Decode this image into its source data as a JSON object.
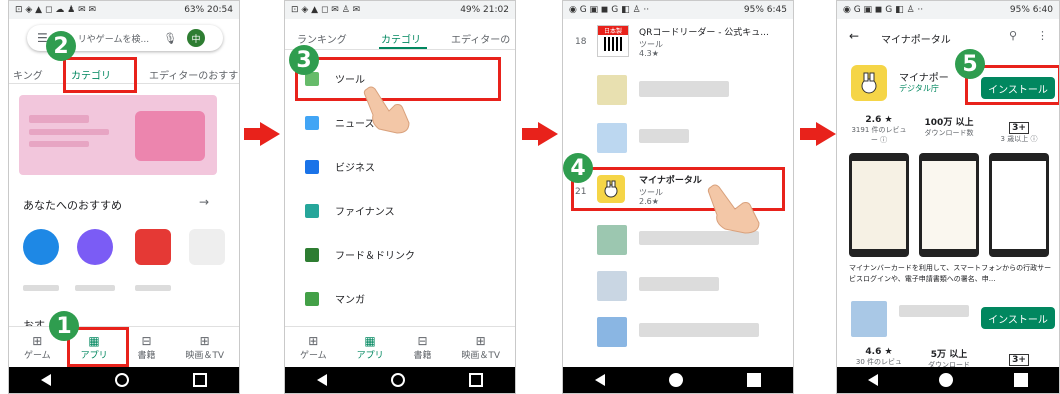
{
  "screen1": {
    "status_left": "⊡ ◈ ▲ ◻ ☁ ♟ ✉ ✉",
    "status_right": "63% 20:54",
    "search_placeholder": "リやゲームを検...",
    "avatar_letter": "中",
    "tabs": [
      "キング",
      "カテゴリ",
      "エディターのおすす"
    ],
    "section_title": "あなたへのおすすめ",
    "section_arrow": "→",
    "partial_heading": "おす",
    "bottom_nav": [
      {
        "icon": "⊞",
        "label": "ゲーム"
      },
      {
        "icon": "▦",
        "label": "アプリ"
      },
      {
        "icon": "⊟",
        "label": "書籍"
      },
      {
        "icon": "⊞",
        "label": "映画＆TV"
      }
    ],
    "badge": "2",
    "badge_bottom": "1"
  },
  "screen2": {
    "status_left": "⊡ ◈ ▲ ◻ ✉ ♙ ✉",
    "status_right": "49% 21:02",
    "tabs": [
      "ランキング",
      "カテゴリ",
      "エディターの"
    ],
    "categories": [
      {
        "label": "ツール",
        "color": "#4caf50"
      },
      {
        "label": "ニュース＆",
        "color": "#2196f3"
      },
      {
        "label": "ビジネス",
        "color": "#1a73e8"
      },
      {
        "label": "ファイナンス",
        "color": "#26a69a"
      },
      {
        "label": "フード＆ドリンク",
        "color": "#2e7d32"
      },
      {
        "label": "マンガ",
        "color": "#43a047"
      }
    ],
    "bottom_nav": [
      {
        "icon": "⊞",
        "label": "ゲーム"
      },
      {
        "icon": "▦",
        "label": "アプリ"
      },
      {
        "icon": "⊟",
        "label": "書籍"
      },
      {
        "icon": "⊞",
        "label": "映画＆TV"
      }
    ],
    "badge": "3"
  },
  "screen3": {
    "status_left": "◉ G ▣ ◼ G ◧ ♙ ··",
    "status_right": "95% 6:45",
    "top_rank": "18",
    "top_title": "QRコードリーダー - 公式キュ...",
    "top_sub": "ツール",
    "top_rating": "4.3★",
    "top_badge": "日本製",
    "highlight_rank": "21",
    "highlight_title": "マイナポータル",
    "highlight_sub": "ツール",
    "highlight_rating": "2.6★",
    "badge": "4"
  },
  "screen4": {
    "status_left": "◉ G ▣ ◼ G ◧ ♙ ··",
    "status_right": "95% 6:40",
    "title": "マイナポータル",
    "app_name": "マイナポー",
    "developer": "デジタル庁",
    "install": "インストール",
    "stats": [
      {
        "top": "2.6 ★",
        "bottom": "3191 件のレビュー ⓘ"
      },
      {
        "top": "100万 以上",
        "bottom": "ダウンロード数"
      },
      {
        "top": "3+",
        "bottom": "3 歳以上 ⓘ"
      }
    ],
    "description": "マイナンバーカードを利用して、スマートフォンからの行政サービスログインや、電子申請書類への署名、申...",
    "install2": "インストール",
    "stats2": [
      {
        "top": "4.6 ★",
        "bottom": "30 件のレビュ"
      },
      {
        "top": "5万 以上",
        "bottom": "ダウンロード"
      },
      {
        "top": "3+",
        "bottom": ""
      }
    ],
    "badge": "5"
  }
}
